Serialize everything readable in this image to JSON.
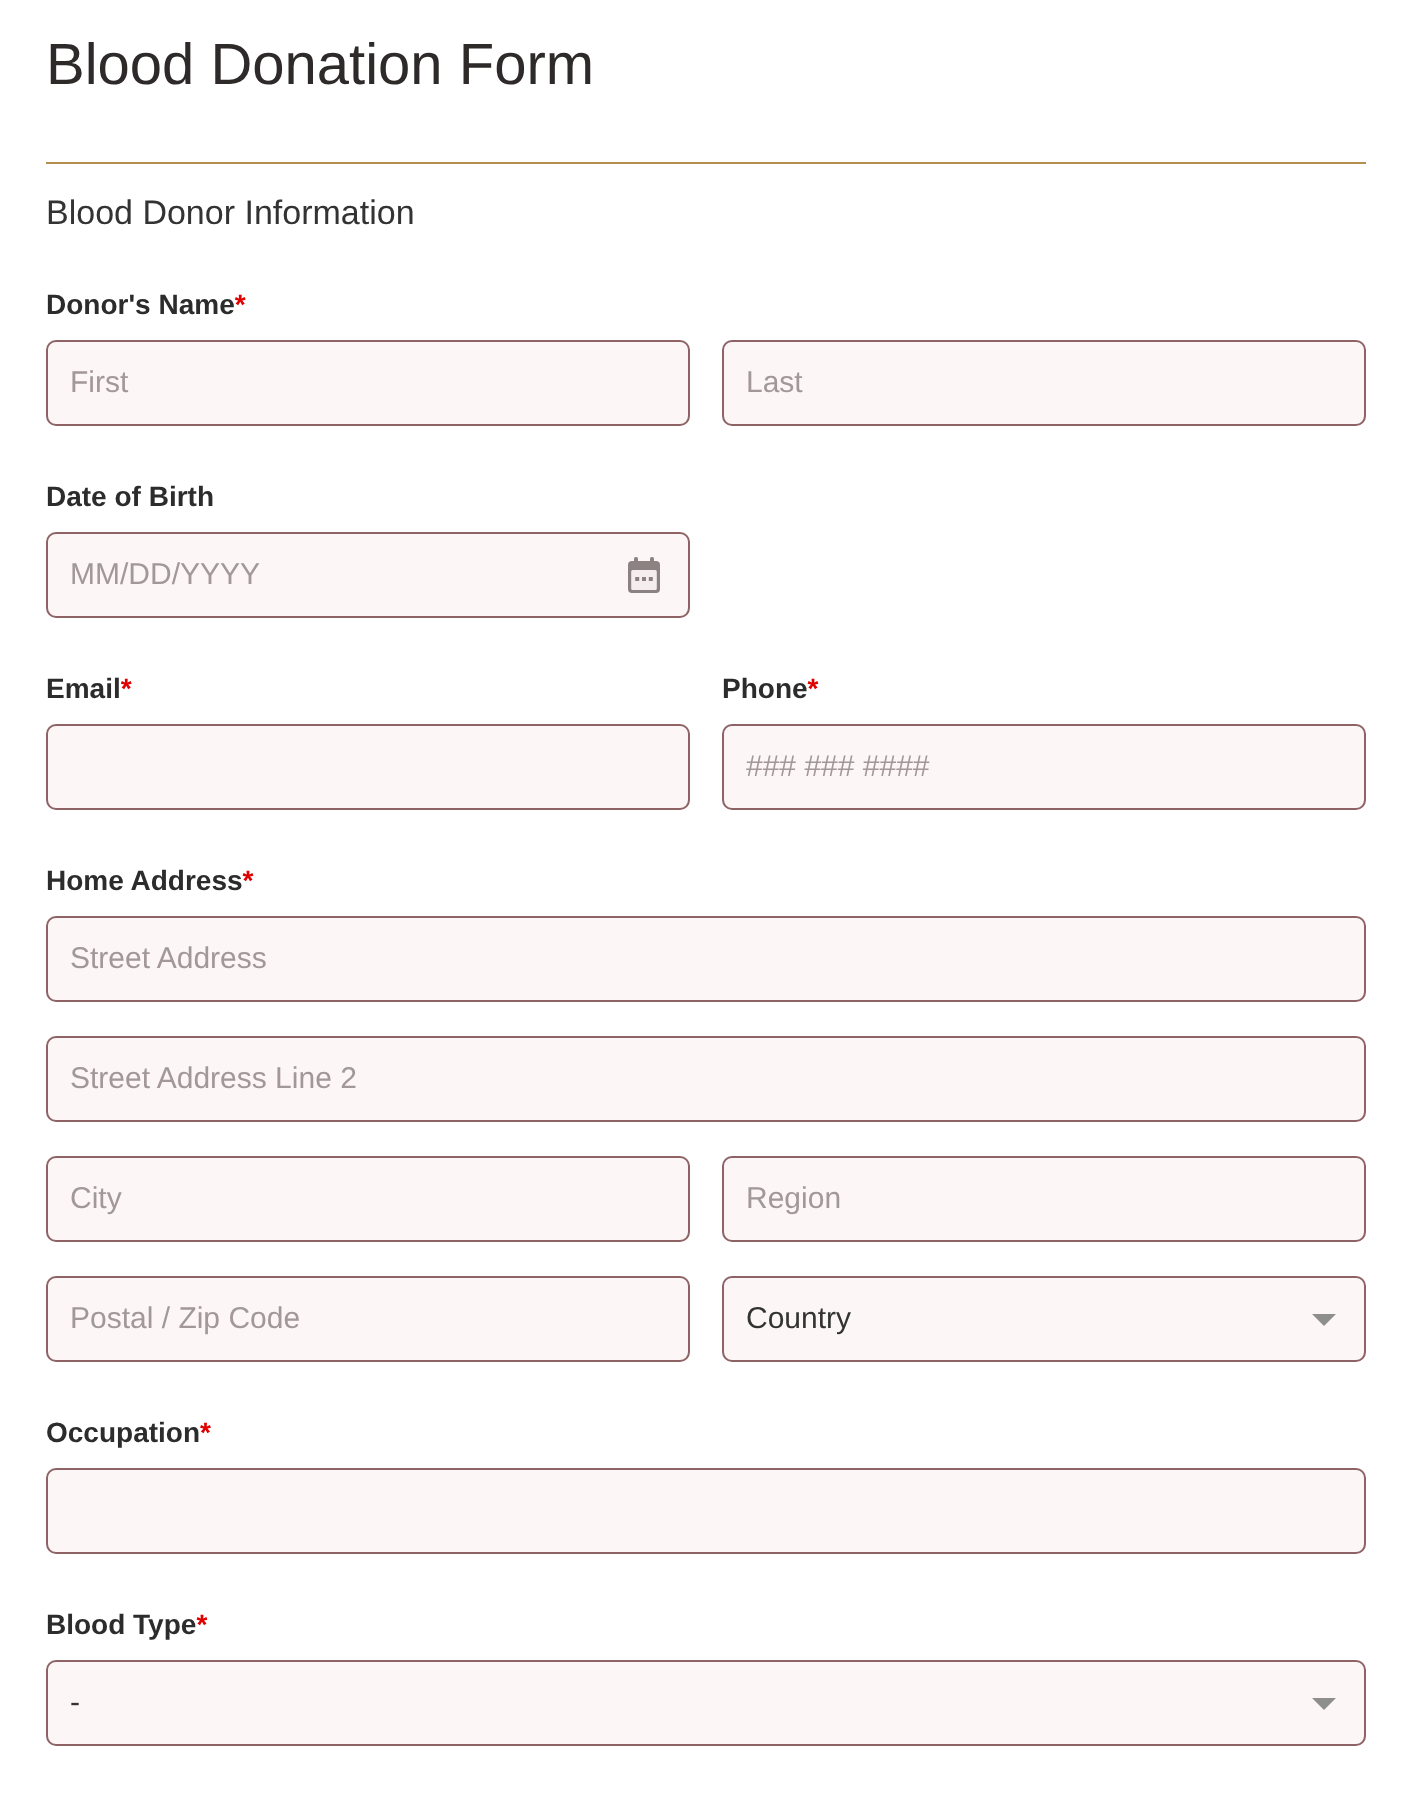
{
  "title": "Blood Donation Form",
  "section": "Blood Donor Information",
  "rows": [
    [
      {
        "label": "Donor's Name",
        "required_mark": "*",
        "lines": [
          [
            {
              "kind": "text",
              "placeholder": "First"
            },
            {
              "kind": "text",
              "placeholder": "Last"
            }
          ]
        ]
      }
    ],
    [
      {
        "label": "Date of Birth",
        "lines": [
          [
            {
              "kind": "date",
              "placeholder": "MM/DD/YYYY"
            }
          ]
        ]
      }
    ],
    [
      {
        "label": "Email",
        "required_mark": "*",
        "lines": [
          [
            {
              "kind": "text"
            }
          ]
        ]
      },
      {
        "label": "Phone",
        "required_mark": "*",
        "lines": [
          [
            {
              "kind": "text",
              "placeholder": "### ### ####"
            }
          ]
        ]
      }
    ],
    [
      {
        "label": "Home Address",
        "required_mark": "*",
        "lines": [
          [
            {
              "kind": "text",
              "placeholder": "Street Address"
            }
          ],
          [
            {
              "kind": "text",
              "placeholder": "Street Address Line 2"
            }
          ],
          [
            {
              "kind": "text",
              "placeholder": "City"
            },
            {
              "kind": "text",
              "placeholder": "Region"
            }
          ],
          [
            {
              "kind": "text",
              "placeholder": "Postal / Zip Code"
            },
            {
              "kind": "select",
              "value": "Country"
            }
          ]
        ]
      }
    ],
    [
      {
        "label": "Occupation",
        "required_mark": "*",
        "lines": [
          [
            {
              "kind": "text"
            }
          ]
        ]
      }
    ],
    [
      {
        "label": "Blood Type",
        "required_mark": "*",
        "lines": [
          [
            {
              "kind": "select",
              "value": "-"
            }
          ]
        ]
      }
    ]
  ]
}
